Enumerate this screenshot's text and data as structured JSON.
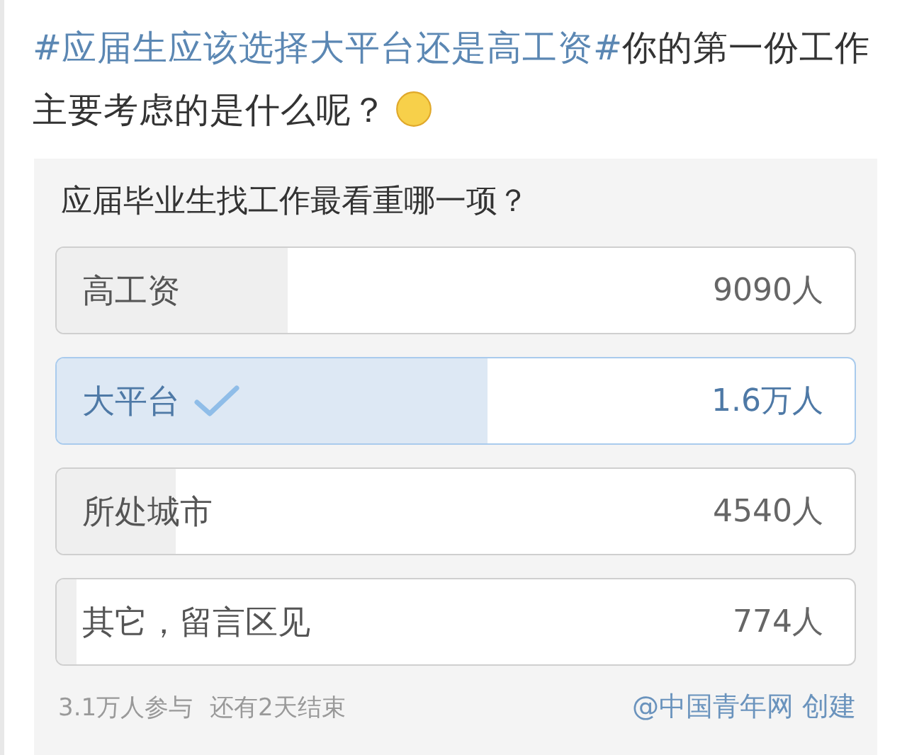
{
  "post": {
    "text_parts": [
      {
        "kind": "hashtag",
        "text": "#应届生应该选择大平台还是高工资#"
      },
      {
        "kind": "plain",
        "text": "你的第一份工作主要考虑的是什么呢？"
      },
      {
        "kind": "emoji"
      }
    ]
  },
  "poll": {
    "title": "应届毕业生找工作最看重哪一项？",
    "options": [
      {
        "label": "高工资",
        "count": "9090人",
        "level": 0.29,
        "selected": false
      },
      {
        "label": "大平台",
        "count": "1.6万人",
        "level": 0.54,
        "selected": true
      },
      {
        "label": "所处城市",
        "count": "4540人",
        "level": 0.15,
        "selected": false
      },
      {
        "label": "其它，留言区见",
        "count": "774人",
        "level": 0.025,
        "selected": false
      }
    ],
    "participants": "3.1万人参与",
    "remaining": "还有2天结束",
    "creator": "@中国青年网 创建"
  }
}
